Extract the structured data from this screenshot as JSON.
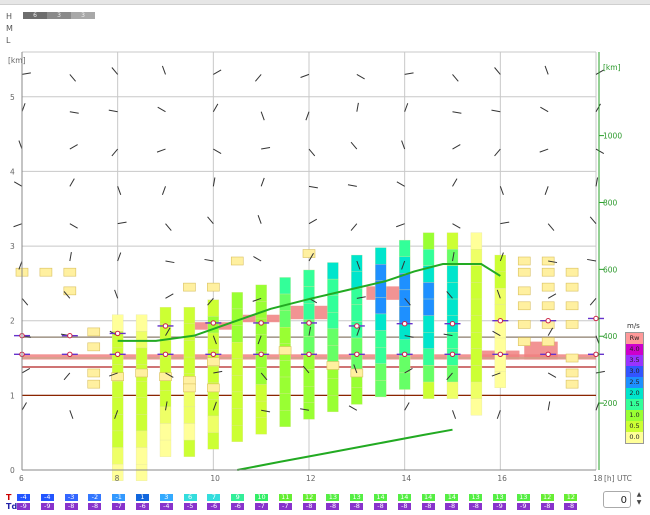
{
  "cloud_layers": {
    "labels": [
      "H",
      "M",
      "L"
    ],
    "high_values": [
      "6",
      "3",
      "3"
    ]
  },
  "chart_data": {
    "type": "time-height cross-section",
    "x_unit": "[h] UTC",
    "x_ticks": [
      6,
      8,
      10,
      12,
      14,
      16,
      18
    ],
    "xlim": [
      6,
      18
    ],
    "left_axis": {
      "unit": "[km]",
      "ticks": [
        0,
        1,
        2,
        3,
        4,
        5
      ],
      "ylim": [
        0,
        5.6
      ]
    },
    "right_axis": {
      "unit": "[km]",
      "ticks": [
        200,
        400,
        600,
        800,
        1000
      ],
      "ylim": [
        0,
        1000
      ],
      "color": "#2aa02a"
    },
    "boundary_layer_height_km": [
      [
        8,
        1.73
      ],
      [
        8.8,
        1.73
      ],
      [
        9.6,
        1.8
      ],
      [
        10.4,
        1.98
      ],
      [
        11.2,
        2.16
      ],
      [
        12,
        2.29
      ],
      [
        12.8,
        2.41
      ],
      [
        13.6,
        2.53
      ],
      [
        14.2,
        2.66
      ],
      [
        14.8,
        2.76
      ],
      [
        15.6,
        2.76
      ],
      [
        16,
        2.6
      ]
    ],
    "cloud_base_line_km": [
      [
        10.5,
        0.0
      ],
      [
        11.4,
        0.11
      ],
      [
        12.4,
        0.23
      ],
      [
        13.4,
        0.35
      ],
      [
        14.4,
        0.47
      ],
      [
        15.0,
        0.54
      ]
    ],
    "ref_lines_km": [
      {
        "y": 1.0,
        "color": "#8b2500"
      },
      {
        "y": 1.38,
        "color": "#b22222"
      },
      {
        "y": 1.5,
        "color": "#c9a98a"
      },
      {
        "y": 1.78,
        "color": "#8b7d6b"
      }
    ],
    "pink_bands": [
      {
        "x": [
          6.0,
          18.0
        ],
        "y": [
          1.48,
          1.55
        ]
      },
      {
        "x": [
          9.6,
          10.5
        ],
        "y": [
          1.88,
          1.98
        ]
      },
      {
        "x": [
          10.6,
          11.4
        ],
        "y": [
          1.98,
          2.08
        ]
      },
      {
        "x": [
          11.6,
          12.4
        ],
        "y": [
          2.02,
          2.2
        ]
      },
      {
        "x": [
          13.2,
          14.0
        ],
        "y": [
          2.28,
          2.46
        ]
      },
      {
        "x": [
          15.6,
          16.4
        ],
        "y": [
          1.48,
          1.6
        ]
      },
      {
        "x": [
          16.5,
          17.2
        ],
        "y": [
          1.48,
          1.72
        ]
      }
    ],
    "wind_columns": [
      {
        "x": 8.0,
        "top": 2.08,
        "colors": [
          "#ffff99",
          "#ccff33",
          "#ccff33",
          "#ccff33",
          "#ccff33",
          "#ccff33",
          "#ccff33",
          "#ccff33",
          "#eeff66",
          "#ffff99"
        ]
      },
      {
        "x": 8.5,
        "top": 2.08,
        "colors": [
          "#ffff99",
          "#eeff66",
          "#ccff33",
          "#ccff33",
          "#ccff33",
          "#ccff33",
          "#ccff33",
          "#eeff66",
          "#ffff99",
          "#ffff99"
        ]
      },
      {
        "x": 9.0,
        "top": 2.18,
        "colors": [
          "#ccff33",
          "#ccff33",
          "#ccff33",
          "#ccff33",
          "#ccff33",
          "#ccff33",
          "#eeff66",
          "#ffff99",
          "#ffff99"
        ]
      },
      {
        "x": 9.5,
        "top": 2.18,
        "colors": [
          "#ccff33",
          "#ccff33",
          "#ccff33",
          "#ccff33",
          "#ccff33",
          "#eeff66",
          "#eeff66",
          "#ffff99",
          "#ccff33"
        ]
      },
      {
        "x": 10.0,
        "top": 2.28,
        "colors": [
          "#ccff33",
          "#99ff33",
          "#ccff33",
          "#ccff33",
          "#ccff33",
          "#ccff33",
          "#ccff33",
          "#eeff66",
          "#ccff33"
        ]
      },
      {
        "x": 10.5,
        "top": 2.38,
        "colors": [
          "#99ff33",
          "#99ff33",
          "#99ff33",
          "#ccff33",
          "#ccff33",
          "#ccff33",
          "#ccff33",
          "#ccff33",
          "#ccff33"
        ]
      },
      {
        "x": 11.0,
        "top": 2.48,
        "colors": [
          "#99ff33",
          "#99ff33",
          "#99ff33",
          "#99ff33",
          "#99ff33",
          "#99ff33",
          "#ccff33",
          "#ccff33",
          "#ccff33"
        ]
      },
      {
        "x": 11.5,
        "top": 2.58,
        "colors": [
          "#33ff99",
          "#66ff66",
          "#66ff66",
          "#99ff33",
          "#99ff33",
          "#99ff33",
          "#99ff33",
          "#99ff33",
          "#99ff33"
        ]
      },
      {
        "x": 12.0,
        "top": 2.68,
        "colors": [
          "#33ff99",
          "#33ff99",
          "#33ff99",
          "#66ff66",
          "#66ff66",
          "#99ff33",
          "#99ff33",
          "#99ff33",
          "#99ff33"
        ]
      },
      {
        "x": 12.5,
        "top": 2.78,
        "colors": [
          "#00e5cc",
          "#33ff99",
          "#33ff99",
          "#33ff99",
          "#66ff66",
          "#66ff66",
          "#99ff33",
          "#99ff33",
          "#99ff33"
        ]
      },
      {
        "x": 13.0,
        "top": 2.88,
        "colors": [
          "#00e5cc",
          "#00e5cc",
          "#33ff99",
          "#33ff99",
          "#33ff99",
          "#66ff66",
          "#66ff66",
          "#99ff33",
          "#99ff33"
        ]
      },
      {
        "x": 13.5,
        "top": 2.98,
        "colors": [
          "#00e5cc",
          "#1e90ff",
          "#1e90ff",
          "#1e90ff",
          "#00e5cc",
          "#33ff99",
          "#33ff99",
          "#66ff66",
          "#66ff66"
        ]
      },
      {
        "x": 14.0,
        "top": 3.08,
        "colors": [
          "#33ff99",
          "#00e5cc",
          "#1e90ff",
          "#1e90ff",
          "#1e90ff",
          "#00e5cc",
          "#33ff99",
          "#66ff66",
          "#66ff66"
        ]
      },
      {
        "x": 14.5,
        "top": 3.18,
        "colors": [
          "#99ff33",
          "#33ff99",
          "#00e5cc",
          "#1e90ff",
          "#1e90ff",
          "#00e5cc",
          "#00e5cc",
          "#33ff99",
          "#66ff66",
          "#ccff33"
        ]
      },
      {
        "x": 15.0,
        "top": 3.18,
        "colors": [
          "#ccff33",
          "#66ff66",
          "#00e5cc",
          "#00e5cc",
          "#00e5cc",
          "#00e5cc",
          "#33ff99",
          "#33ff99",
          "#66ff66",
          "#eeff66"
        ]
      },
      {
        "x": 15.5,
        "top": 3.18,
        "colors": [
          "#ffff99",
          "#eeff66",
          "#ccff33",
          "#ccff33",
          "#ccff33",
          "#ccff33",
          "#ccff33",
          "#ccff33",
          "#ccff33",
          "#eeff66",
          "#ffff99"
        ]
      },
      {
        "x": 16.0,
        "top": 2.88,
        "colors": [
          "#ccff33",
          "#ccff33",
          "#eeff66",
          "#eeff66",
          "#ffff99",
          "#ffff99",
          "#ffff99",
          "#ffff99"
        ]
      }
    ],
    "isolated_boxes": [
      [
        6.0,
        2.65
      ],
      [
        6.5,
        2.65
      ],
      [
        7.0,
        2.65
      ],
      [
        7.0,
        2.4
      ],
      [
        7.5,
        1.85
      ],
      [
        7.5,
        1.65
      ],
      [
        7.5,
        1.3
      ],
      [
        7.5,
        1.15
      ],
      [
        8.0,
        1.25
      ],
      [
        8.5,
        1.3
      ],
      [
        9.0,
        1.25
      ],
      [
        9.5,
        1.2
      ],
      [
        9.5,
        1.1
      ],
      [
        10.0,
        1.45
      ],
      [
        10.0,
        1.1
      ],
      [
        9.5,
        2.45
      ],
      [
        10.0,
        2.45
      ],
      [
        10.5,
        2.8
      ],
      [
        11.5,
        1.6
      ],
      [
        12.0,
        2.9
      ],
      [
        12.5,
        1.4
      ],
      [
        13.0,
        1.3
      ],
      [
        16.5,
        2.65
      ],
      [
        17.0,
        2.65
      ],
      [
        17.5,
        2.65
      ],
      [
        16.5,
        2.4
      ],
      [
        17.0,
        2.45
      ],
      [
        17.5,
        2.45
      ],
      [
        16.5,
        2.2
      ],
      [
        17.0,
        2.2
      ],
      [
        17.5,
        2.2
      ],
      [
        16.5,
        1.95
      ],
      [
        17.0,
        1.95
      ],
      [
        17.5,
        1.95
      ],
      [
        16.5,
        1.72
      ],
      [
        17.0,
        1.72
      ],
      [
        17.5,
        1.3
      ],
      [
        17.5,
        1.15
      ],
      [
        17.5,
        1.5
      ],
      [
        16.5,
        2.8
      ],
      [
        17.0,
        2.8
      ]
    ],
    "sounding_markers": [
      {
        "x": 6.0,
        "y": 1.55,
        "y2": 1.8
      },
      {
        "x": 7.0,
        "y": 1.55,
        "y2": 1.8
      },
      {
        "x": 8.0,
        "y": 1.55,
        "y2": 1.83
      },
      {
        "x": 9.0,
        "y": 1.55,
        "y2": 1.93
      },
      {
        "x": 10.0,
        "y": 1.55,
        "y2": 1.97
      },
      {
        "x": 11.0,
        "y": 1.55,
        "y2": 1.97
      },
      {
        "x": 12.0,
        "y": 1.55,
        "y2": 1.97
      },
      {
        "x": 13.0,
        "y": 1.55,
        "y2": 1.93
      },
      {
        "x": 14.0,
        "y": 1.55,
        "y2": 1.96
      },
      {
        "x": 15.0,
        "y": 1.55,
        "y2": 1.96
      },
      {
        "x": 16.0,
        "y": 1.55,
        "y2": 2.0
      },
      {
        "x": 17.0,
        "y": 1.55,
        "y2": 2.0
      },
      {
        "x": 18.0,
        "y": 1.55,
        "y2": 2.03
      }
    ]
  },
  "legend": {
    "title": "m/s",
    "items": [
      {
        "label": "Rw",
        "color": "#ff9999"
      },
      {
        "label": "4.0",
        "color": "#cc00cc"
      },
      {
        "label": "3.5",
        "color": "#9933ff"
      },
      {
        "label": "3.0",
        "color": "#3355ff"
      },
      {
        "label": "2.5",
        "color": "#1e90ff"
      },
      {
        "label": "2.0",
        "color": "#00e5cc"
      },
      {
        "label": "1.5",
        "color": "#33ff99"
      },
      {
        "label": "1.0",
        "color": "#99ff33"
      },
      {
        "label": "0.5",
        "color": "#ccff33"
      },
      {
        "label": "0.0",
        "color": "#ffff99"
      }
    ]
  },
  "temperature_row": {
    "t_label": "T",
    "td_label": "Td",
    "T": [
      "-4",
      "-4",
      "-3",
      "-2",
      "-1",
      "1",
      "3",
      "6",
      "7",
      "9",
      "10",
      "11",
      "12",
      "13",
      "13",
      "14",
      "14",
      "14",
      "14",
      "13",
      "13",
      "13",
      "12",
      "12"
    ],
    "Td": [
      "-9",
      "-9",
      "-8",
      "-8",
      "-7",
      "-6",
      "-4",
      "-5",
      "-6",
      "-6",
      "-7",
      "-7",
      "-8",
      "-8",
      "-8",
      "-8",
      "-8",
      "-8",
      "-8",
      "-8",
      "-9",
      "-9",
      "-8",
      "-8"
    ],
    "T_colors": [
      "#2255ff",
      "#2255ff",
      "#3366ff",
      "#3377ff",
      "#3399ff",
      "#1166dd",
      "#33aaff",
      "#33dddd",
      "#33dddd",
      "#33ee99",
      "#33ee66",
      "#66ee33",
      "#66ee33",
      "#55ee44",
      "#55ee44",
      "#55ee44",
      "#55ee44",
      "#55ee44",
      "#55ee44",
      "#55ee44",
      "#55ee44",
      "#55ee44",
      "#66ee33",
      "#66ee33"
    ]
  },
  "spinner": {
    "value": "0"
  }
}
